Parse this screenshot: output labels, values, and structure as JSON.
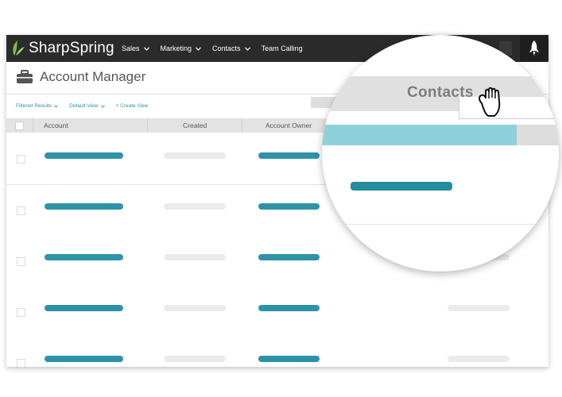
{
  "app": {
    "logo_text": "SharpSpring",
    "nav": [
      "Sales",
      "Marketing",
      "Contacts",
      "Team Calling"
    ]
  },
  "page": {
    "title": "Account Manager"
  },
  "filters": {
    "filtered_results": "Filtered Results",
    "default_view": "Default View",
    "create_view": "+ Create View"
  },
  "table": {
    "columns": [
      "Account",
      "Created",
      "Account Owner"
    ],
    "row_count": 5
  },
  "magnifier": {
    "label": "Contacts"
  },
  "colors": {
    "topbar": "#2b2b2b",
    "accent_teal": "#2d93a8",
    "light_teal": "#8fd0db",
    "logo_green": "#7dbb42"
  },
  "icons": [
    "briefcase-icon",
    "rocket-icon",
    "chevron-down-icon",
    "checkbox-icon",
    "grab-hand-icon"
  ]
}
